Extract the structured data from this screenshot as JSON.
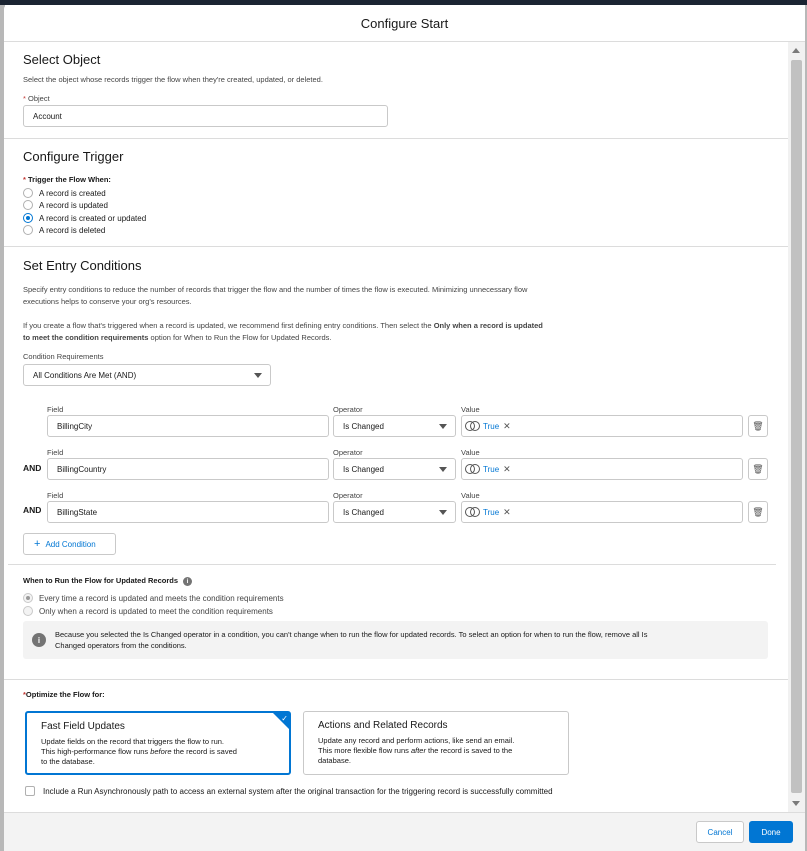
{
  "modal": {
    "title": "Configure Start"
  },
  "select_object": {
    "title": "Select Object",
    "description": "Select the object whose records trigger the flow when they're created, updated, or deleted.",
    "field_required": "*",
    "field_label": "Object",
    "field_value": "Account"
  },
  "configure_trigger": {
    "title": "Configure Trigger",
    "label_required": "*",
    "label": "Trigger the Flow When:",
    "options": [
      {
        "label": "A record is created",
        "selected": false
      },
      {
        "label": "A record is updated",
        "selected": false
      },
      {
        "label": "A record is created or updated",
        "selected": true
      },
      {
        "label": "A record is deleted",
        "selected": false
      }
    ]
  },
  "entry_conditions": {
    "title": "Set Entry Conditions",
    "desc1_line1": "Specify entry conditions to reduce the number of records that trigger the flow and the number of times the flow is executed. Minimizing unnecessary flow",
    "desc1_line2": "executions helps to conserve your org's resources.",
    "desc2_pre": "If you create a flow that's triggered when a record is updated, we recommend first defining entry conditions. Then select the ",
    "desc2_bold1": "Only when a record is updated",
    "desc2_bold2": "to meet the condition requirements",
    "desc2_post": " option for When to Run the Flow for Updated Records.",
    "requirements_label": "Condition Requirements",
    "requirements_value": "All Conditions Are Met (AND)",
    "field_header": "Field",
    "operator_header": "Operator",
    "value_header": "Value",
    "and_label": "AND",
    "conditions": [
      {
        "field": "BillingCity",
        "operator": "Is Changed",
        "value": "True"
      },
      {
        "field": "BillingCountry",
        "operator": "Is Changed",
        "value": "True"
      },
      {
        "field": "BillingState",
        "operator": "Is Changed",
        "value": "True"
      }
    ],
    "add_condition": "Add Condition"
  },
  "when_to_run": {
    "title": "When to Run the Flow for Updated Records",
    "options": [
      {
        "label": "Every time a record is updated and meets the condition requirements",
        "selected": true
      },
      {
        "label": "Only when a record is updated to meet the condition requirements",
        "selected": false
      }
    ],
    "info_line1": "Because you selected the Is Changed operator in a condition, you can't change when to run the flow for updated records. To select an option for when to run the flow, remove all Is",
    "info_line2": "Changed operators from the conditions."
  },
  "optimize": {
    "label_required": "*",
    "label": "Optimize the Flow for:",
    "cards": [
      {
        "title": "Fast Field Updates",
        "line1": "Update fields on the record that triggers the flow to run.",
        "line2_pre": "This high-performance flow runs ",
        "line2_em": "before",
        "line2_post": " the record is saved",
        "line3": "to the database.",
        "selected": true
      },
      {
        "title": "Actions and Related Records",
        "line1": "Update any record and perform actions, like send an email.",
        "line2_pre": "This more flexible flow runs ",
        "line2_em": "after",
        "line2_post": " the record is saved to the",
        "line3": "database.",
        "selected": false
      }
    ],
    "async_label": "Include a Run Asynchronously path to access an external system after the original transaction for the triggering record is successfully committed"
  },
  "footer": {
    "cancel": "Cancel",
    "done": "Done"
  },
  "colors": {
    "brand": "#0176d3",
    "required": "#c23934"
  },
  "icons": {
    "delete": "trash-icon",
    "add": "plus-icon",
    "info": "info-icon",
    "value_type": "toggle-icon",
    "remove": "close-icon",
    "caret": "chevron-down-icon"
  }
}
